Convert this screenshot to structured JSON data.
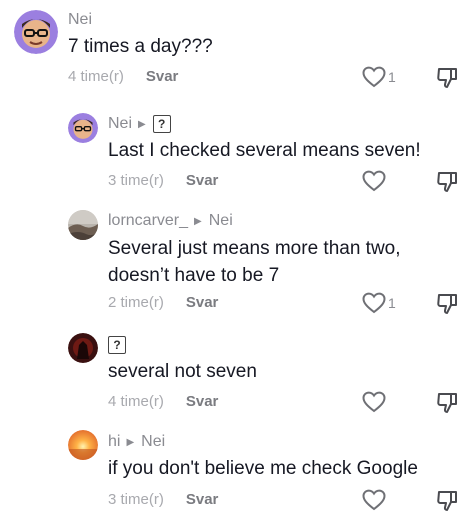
{
  "comments": [
    {
      "username": "Nei",
      "reply_to": "",
      "text": "7 times a day???",
      "time": "4 time(r)",
      "reply_label": "Svar",
      "likes": "1"
    },
    {
      "username": "Nei",
      "reply_to": "?",
      "text": "Last I checked several means seven!",
      "time": "3 time(r)",
      "reply_label": "Svar",
      "likes": ""
    },
    {
      "username": "lorncarver_",
      "reply_to": "Nei",
      "text_line1": "Several just means more than two,",
      "text_line2": "doesn’t have to be 7",
      "time": "2 time(r)",
      "reply_label": "Svar",
      "likes": "1"
    },
    {
      "username": "?",
      "reply_to": "",
      "text": "several not seven",
      "time": "4 time(r)",
      "reply_label": "Svar",
      "likes": ""
    },
    {
      "username": "hi",
      "reply_to": "Nei",
      "text": "if you don't believe me check Google",
      "time": "3 time(r)",
      "reply_label": "Svar",
      "likes": ""
    }
  ],
  "icons": {
    "reply_arrow": "triangle-right-icon",
    "like": "heart-icon",
    "dislike": "thumbs-down-icon"
  },
  "colors": {
    "text": "#161823",
    "secondary": "#8a8b91",
    "avatar_purple": "#8e6fd8"
  }
}
